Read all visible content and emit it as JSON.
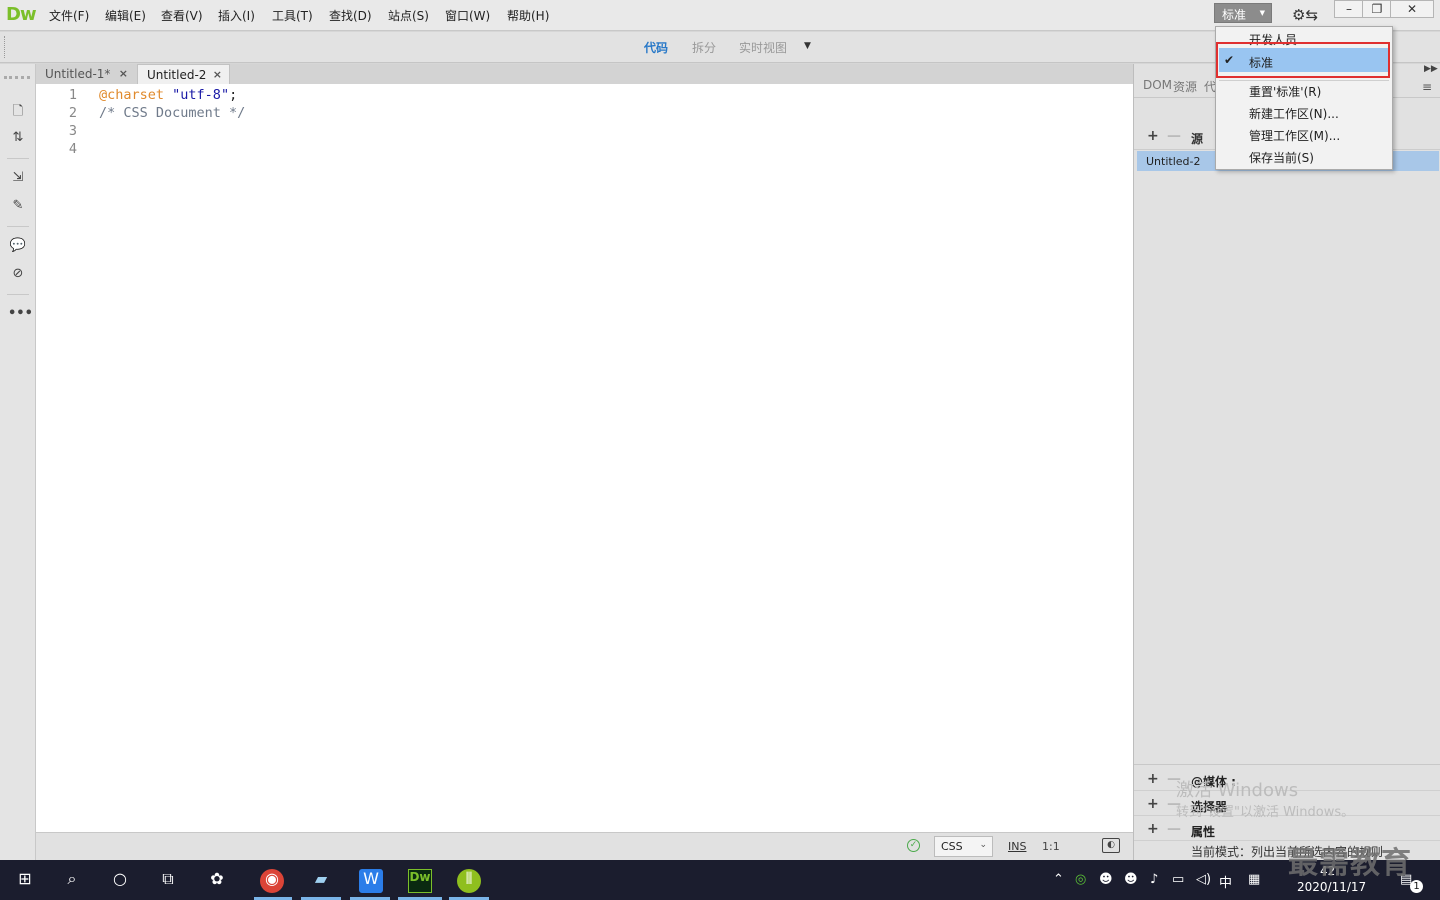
{
  "app": {
    "logo": "Dw",
    "menu": [
      "文件(F)",
      "编辑(E)",
      "查看(V)",
      "插入(I)",
      "工具(T)",
      "查找(D)",
      "站点(S)",
      "窗口(W)",
      "帮助(H)"
    ],
    "workspace_label": "标准"
  },
  "views": {
    "code": "代码",
    "split": "拆分",
    "live": "实时视图"
  },
  "tabs": [
    {
      "label": "Untitled-1*",
      "close": "×"
    },
    {
      "label": "Untitled-2",
      "close": "×",
      "active": true
    }
  ],
  "editor": {
    "lines": [
      {
        "num": "1",
        "at": "@charset",
        "str": "\"utf-8\"",
        "punc": ";"
      },
      {
        "num": "2",
        "comment": "/* CSS Document */"
      },
      {
        "num": "3"
      },
      {
        "num": "4"
      }
    ]
  },
  "status": {
    "language": "CSS",
    "insert_mode": "INS",
    "cursor": "1:1"
  },
  "right_panel": {
    "tabs": [
      "DOM",
      "资源",
      "代"
    ],
    "source_label": "源",
    "source_item": "Untitled-2",
    "sections": [
      "@媒体 :",
      "选择器",
      "属性"
    ],
    "mode_text": "当前模式：列出当前所选内容的规则"
  },
  "workspace_menu": {
    "items": [
      "开发人员",
      "标准",
      "重置'标准'(R)",
      "新建工作区(N)...",
      "管理工作区(M)...",
      "保存当前(S)"
    ],
    "selected": "标准"
  },
  "watermark": {
    "line1": "激活 Windows",
    "line2": "转到\"设置\"以激活 Windows。",
    "brand": "最需教育"
  },
  "taskbar": {
    "tray_ime": "中",
    "clock_time": "42",
    "clock_date": "2020/11/17",
    "notification_count": "1"
  },
  "colors": {
    "accent_blue": "#2979c8",
    "selection_blue": "#99c5f1",
    "highlight_red": "#e03030",
    "dw_green": "#7bbf2a",
    "taskbar_bg": "#1b1d2e"
  }
}
